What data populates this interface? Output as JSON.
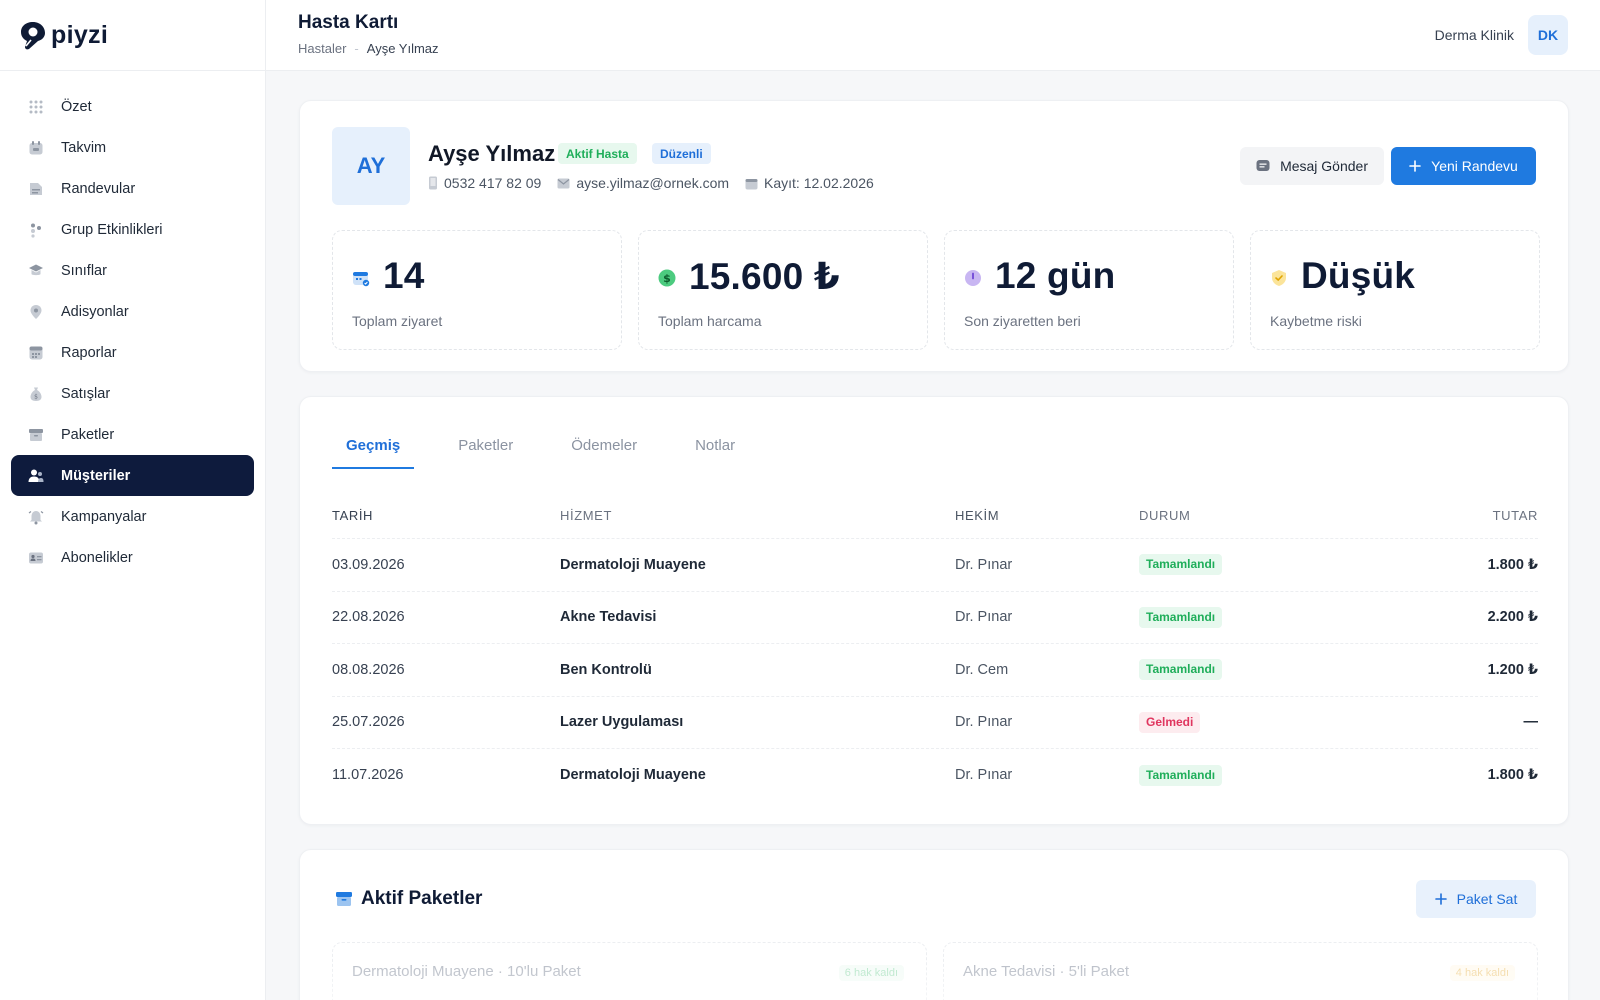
{
  "app": {
    "logo_text": "piyzi"
  },
  "sidebar": {
    "items": [
      {
        "label": "Özet",
        "icon": "grid-dots-icon",
        "active": false
      },
      {
        "label": "Takvim",
        "icon": "calendar-icon",
        "active": false
      },
      {
        "label": "Randevular",
        "icon": "appointments-icon",
        "active": false
      },
      {
        "label": "Grup Etkinlikleri",
        "icon": "group-icon",
        "active": false
      },
      {
        "label": "Sınıflar",
        "icon": "graduation-cap-icon",
        "active": false
      },
      {
        "label": "Adisyonlar",
        "icon": "location-pin-icon",
        "active": false
      },
      {
        "label": "Raporlar",
        "icon": "report-icon",
        "active": false
      },
      {
        "label": "Satışlar",
        "icon": "money-bag-icon",
        "active": false
      },
      {
        "label": "Paketler",
        "icon": "package-icon",
        "active": false
      },
      {
        "label": "Müşteriler",
        "icon": "users-icon",
        "active": true
      },
      {
        "label": "Kampanyalar",
        "icon": "bell-icon",
        "active": false
      },
      {
        "label": "Abonelikler",
        "icon": "id-card-icon",
        "active": false
      }
    ]
  },
  "header": {
    "title": "Hasta Kartı",
    "breadcrumb": {
      "parent": "Hastaler",
      "separator": "-",
      "current": "Ayşe Yılmaz"
    },
    "clinic": "Derma Klinik",
    "user_initials": "DK"
  },
  "patient": {
    "initials": "AY",
    "name": "Ayşe Yılmaz",
    "badges": [
      "Aktif Hasta",
      "Düzenli"
    ],
    "phone": "0532 417 82 09",
    "email": "ayse.yilmaz@ornek.com",
    "registered": "Kayıt: 12.02.2026"
  },
  "actions": {
    "message": "Mesaj Gönder",
    "new_appointment": "Yeni Randevu"
  },
  "stats": [
    {
      "value": "14",
      "label": "Toplam ziyaret",
      "icon": "calendar-check-icon"
    },
    {
      "value": "15.600 ₺",
      "label": "Toplam harcama",
      "icon": "dollar-icon"
    },
    {
      "value": "12 gün",
      "label": "Son ziyaretten beri",
      "icon": "clock-icon"
    },
    {
      "value": "Düşük",
      "label": "Kaybetme riski",
      "icon": "shield-icon"
    }
  ],
  "tabs": [
    {
      "label": "Geçmiş",
      "active": true
    },
    {
      "label": "Paketler",
      "active": false
    },
    {
      "label": "Ödemeler",
      "active": false
    },
    {
      "label": "Notlar",
      "active": false
    }
  ],
  "history": {
    "columns": [
      "TARİH",
      "HİZMET",
      "HEKİM",
      "DURUM",
      "TUTAR"
    ],
    "rows": [
      {
        "date": "03.09.2026",
        "service": "Dermatoloji Muayene",
        "doctor": "Dr. Pınar",
        "status": "Tamamlandı",
        "amount": "1.800 ₺"
      },
      {
        "date": "22.08.2026",
        "service": "Akne Tedavisi",
        "doctor": "Dr. Pınar",
        "status": "Tamamlandı",
        "amount": "2.200 ₺"
      },
      {
        "date": "08.08.2026",
        "service": "Ben Kontrolü",
        "doctor": "Dr. Cem",
        "status": "Tamamlandı",
        "amount": "1.200 ₺"
      },
      {
        "date": "25.07.2026",
        "service": "Lazer Uygulaması",
        "doctor": "Dr. Pınar",
        "status": "Gelmedi",
        "amount": "—"
      },
      {
        "date": "11.07.2026",
        "service": "Dermatoloji Muayene",
        "doctor": "Dr. Pınar",
        "status": "Tamamlandı",
        "amount": "1.800 ₺"
      }
    ]
  },
  "packages": {
    "title": "Aktif Paketler",
    "sell_button": "Paket Sat",
    "items": [
      {
        "name": "Dermatoloji Muayene · 10'lu Paket",
        "remaining": "6 hak kaldı"
      },
      {
        "name": "Akne Tedavisi · 5'li Paket",
        "remaining": "4 hak kaldı"
      }
    ]
  },
  "colors": {
    "accent": "#1f7ae0",
    "sidebar_active": "#0e1b3d",
    "success": "#1fae5a",
    "danger": "#e0365f"
  }
}
